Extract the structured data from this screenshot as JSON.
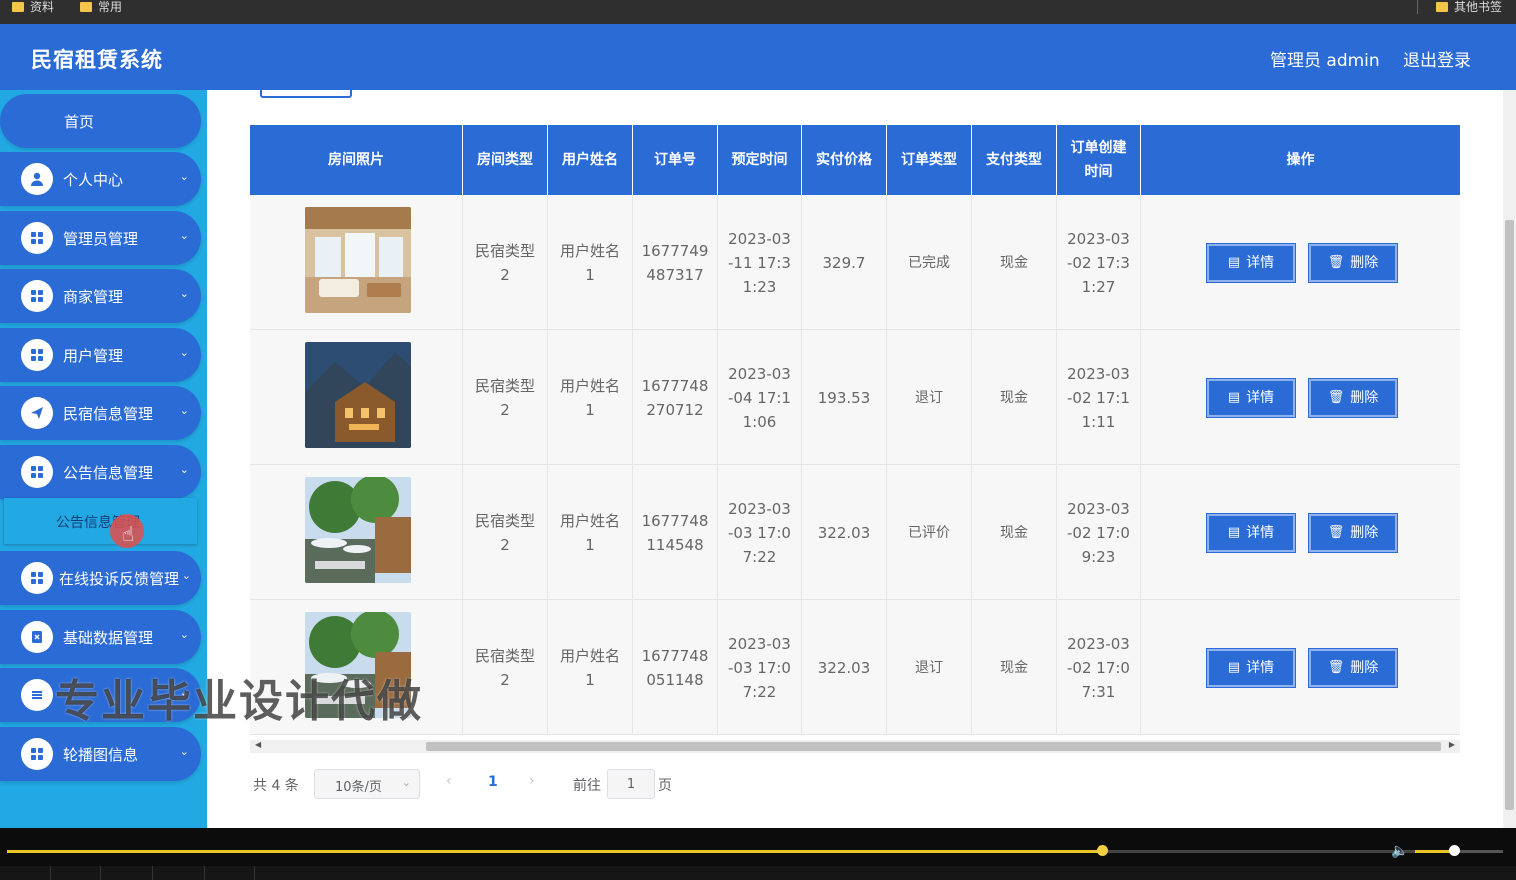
{
  "bookmarks": {
    "left": [
      "资料",
      "常用"
    ],
    "right": "其他书签"
  },
  "header": {
    "title": "民宿租赁系统",
    "admin": "管理员 admin",
    "logout": "退出登录"
  },
  "sidebar": {
    "home": "首页",
    "items": [
      {
        "label": "个人中心",
        "icon": "user-icon"
      },
      {
        "label": "管理员管理",
        "icon": "grid-icon"
      },
      {
        "label": "商家管理",
        "icon": "grid-icon"
      },
      {
        "label": "用户管理",
        "icon": "grid-icon"
      },
      {
        "label": "民宿信息管理",
        "icon": "send-icon"
      },
      {
        "label": "公告信息管理",
        "icon": "grid-icon"
      },
      {
        "label": "在线投诉反馈管理",
        "icon": "grid-icon"
      },
      {
        "label": "基础数据管理",
        "icon": "document-icon"
      },
      {
        "label": "",
        "icon": "list-icon"
      },
      {
        "label": "轮播图信息",
        "icon": "grid-icon"
      }
    ],
    "subitem": "公告信息管理"
  },
  "table": {
    "headers": [
      "房间照片",
      "房间类型",
      "用户姓名",
      "订单号",
      "预定时间",
      "实付价格",
      "订单类型",
      "支付类型",
      "订单创建\n时间",
      "操作"
    ],
    "rows": [
      {
        "room_type": "民宿类型\n2",
        "user": "用户姓名\n1",
        "order_no": "1677749\n487317",
        "reserve_time": "2023-03\n-11 17:3\n1:23",
        "price": "329.7",
        "order_type": "已完成",
        "pay_type": "现金",
        "create_time": "2023-03\n-02 17:3\n1:27"
      },
      {
        "room_type": "民宿类型\n2",
        "user": "用户姓名\n1",
        "order_no": "1677748\n270712",
        "reserve_time": "2023-03\n-04 17:1\n1:06",
        "price": "193.53",
        "order_type": "退订",
        "pay_type": "现金",
        "create_time": "2023-03\n-02 17:1\n1:11"
      },
      {
        "room_type": "民宿类型\n2",
        "user": "用户姓名\n1",
        "order_no": "1677748\n114548",
        "reserve_time": "2023-03\n-03 17:0\n7:22",
        "price": "322.03",
        "order_type": "已评价",
        "pay_type": "现金",
        "create_time": "2023-03\n-02 17:0\n9:23"
      },
      {
        "room_type": "民宿类型\n2",
        "user": "用户姓名\n1",
        "order_no": "1677748\n051148",
        "reserve_time": "2023-03\n-03 17:0\n7:22",
        "price": "322.03",
        "order_type": "退订",
        "pay_type": "现金",
        "create_time": "2023-03\n-02 17:0\n7:31"
      }
    ],
    "actions": {
      "detail": "详情",
      "delete": "删除"
    }
  },
  "pagination": {
    "total": "共 4 条",
    "page_size": "10条/页",
    "current": "1",
    "goto": "前往",
    "jump_value": "1",
    "page_unit": "页"
  },
  "watermark": "专业毕业设计代做",
  "colors": {
    "primary": "#2b6bd6",
    "sidebar": "#22a8e2",
    "progress": "#e8c526"
  }
}
